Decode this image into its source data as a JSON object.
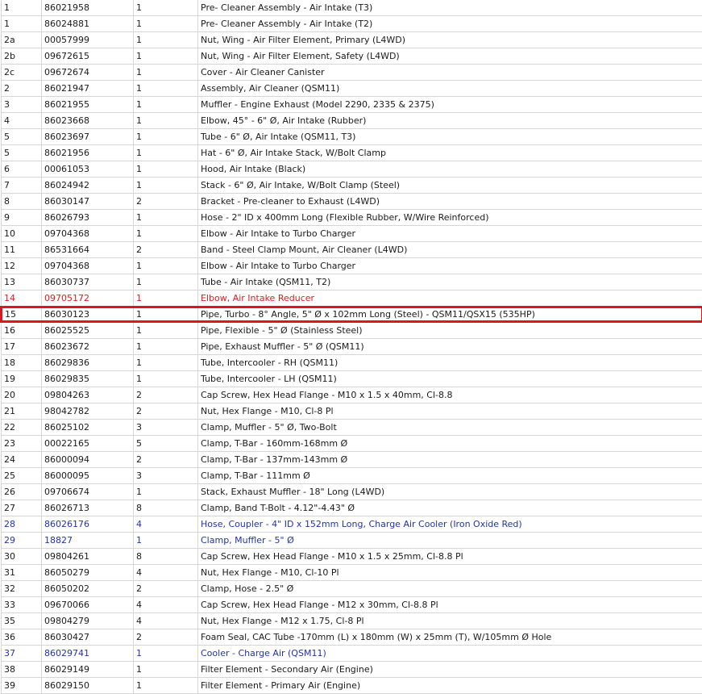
{
  "rows": [
    {
      "ref": "1",
      "part": "86021958",
      "qty": "1",
      "desc": "Pre- Cleaner Assembly - Air Intake (T3)",
      "style": ""
    },
    {
      "ref": "1",
      "part": "86024881",
      "qty": "1",
      "desc": "Pre- Cleaner Assembly - Air Intake (T2)",
      "style": ""
    },
    {
      "ref": "2a",
      "part": "00057999",
      "qty": "1",
      "desc": "Nut, Wing - Air Filter Element, Primary (L4WD)",
      "style": ""
    },
    {
      "ref": "2b",
      "part": "09672615",
      "qty": "1",
      "desc": "Nut, Wing - Air Filter Element, Safety (L4WD)",
      "style": ""
    },
    {
      "ref": "2c",
      "part": "09672674",
      "qty": "1",
      "desc": "Cover - Air Cleaner Canister",
      "style": ""
    },
    {
      "ref": "2",
      "part": "86021947",
      "qty": "1",
      "desc": "Assembly, Air Cleaner (QSM11)",
      "style": ""
    },
    {
      "ref": "3",
      "part": "86021955",
      "qty": "1",
      "desc": "Muffler - Engine Exhaust (Model 2290, 2335 & 2375)",
      "style": ""
    },
    {
      "ref": "4",
      "part": "86023668",
      "qty": "1",
      "desc": "Elbow, 45° - 6\" Ø, Air Intake (Rubber)",
      "style": ""
    },
    {
      "ref": "5",
      "part": "86023697",
      "qty": "1",
      "desc": "Tube - 6\" Ø, Air Intake (QSM11, T3)",
      "style": ""
    },
    {
      "ref": "5",
      "part": "86021956",
      "qty": "1",
      "desc": "Hat - 6\" Ø, Air Intake Stack, W/Bolt Clamp",
      "style": ""
    },
    {
      "ref": "6",
      "part": "00061053",
      "qty": "1",
      "desc": "Hood, Air Intake (Black)",
      "style": ""
    },
    {
      "ref": "7",
      "part": "86024942",
      "qty": "1",
      "desc": "Stack - 6\" Ø, Air Intake, W/Bolt Clamp (Steel)",
      "style": ""
    },
    {
      "ref": "8",
      "part": "86030147",
      "qty": "2",
      "desc": "Bracket - Pre-cleaner to Exhaust (L4WD)",
      "style": ""
    },
    {
      "ref": "9",
      "part": "86026793",
      "qty": "1",
      "desc": "Hose - 2\" ID x 400mm Long (Flexible Rubber, W/Wire Reinforced)",
      "style": ""
    },
    {
      "ref": "10",
      "part": "09704368",
      "qty": "1",
      "desc": "Elbow - Air Intake to Turbo Charger",
      "style": ""
    },
    {
      "ref": "11",
      "part": "86531664",
      "qty": "2",
      "desc": "Band - Steel Clamp Mount, Air Cleaner (L4WD)",
      "style": ""
    },
    {
      "ref": "12",
      "part": "09704368",
      "qty": "1",
      "desc": "Elbow - Air Intake to Turbo Charger",
      "style": ""
    },
    {
      "ref": "13",
      "part": "86030737",
      "qty": "1",
      "desc": "Tube - Air Intake (QSM11, T2)",
      "style": ""
    },
    {
      "ref": "14",
      "part": "09705172",
      "qty": "1",
      "desc": "Elbow, Air Intake Reducer",
      "style": "red"
    },
    {
      "ref": "15",
      "part": "86030123",
      "qty": "1",
      "desc": "Pipe, Turbo - 8° Angle, 5\" Ø x 102mm Long (Steel) - QSM11/QSX15 (535HP)",
      "style": "selected"
    },
    {
      "ref": "16",
      "part": "86025525",
      "qty": "1",
      "desc": "Pipe, Flexible - 5\" Ø (Stainless Steel)",
      "style": ""
    },
    {
      "ref": "17",
      "part": "86023672",
      "qty": "1",
      "desc": "Pipe, Exhaust Muffler - 5\" Ø (QSM11)",
      "style": ""
    },
    {
      "ref": "18",
      "part": "86029836",
      "qty": "1",
      "desc": "Tube, Intercooler - RH (QSM11)",
      "style": ""
    },
    {
      "ref": "19",
      "part": "86029835",
      "qty": "1",
      "desc": "Tube, Intercooler - LH (QSM11)",
      "style": ""
    },
    {
      "ref": "20",
      "part": "09804263",
      "qty": "2",
      "desc": "Cap Screw, Hex Head Flange - M10 x 1.5 x 40mm, Cl-8.8",
      "style": ""
    },
    {
      "ref": "21",
      "part": "98042782",
      "qty": "2",
      "desc": "Nut, Hex Flange - M10, Cl-8 Pl",
      "style": ""
    },
    {
      "ref": "22",
      "part": "86025102",
      "qty": "3",
      "desc": "Clamp, Muffler - 5\" Ø, Two-Bolt",
      "style": ""
    },
    {
      "ref": "23",
      "part": "00022165",
      "qty": "5",
      "desc": "Clamp, T-Bar - 160mm-168mm Ø",
      "style": ""
    },
    {
      "ref": "24",
      "part": "86000094",
      "qty": "2",
      "desc": "Clamp, T-Bar - 137mm-143mm Ø",
      "style": ""
    },
    {
      "ref": "25",
      "part": "86000095",
      "qty": "3",
      "desc": "Clamp, T-Bar - 111mm Ø",
      "style": ""
    },
    {
      "ref": "26",
      "part": "09706674",
      "qty": "1",
      "desc": "Stack, Exhaust Muffler - 18\" Long (L4WD)",
      "style": ""
    },
    {
      "ref": "27",
      "part": "86026713",
      "qty": "8",
      "desc": "Clamp, Band T-Bolt - 4.12\"-4.43\" Ø",
      "style": ""
    },
    {
      "ref": "28",
      "part": "86026176",
      "qty": "4",
      "desc": "Hose, Coupler - 4\" ID x 152mm Long, Charge Air Cooler (Iron Oxide Red)",
      "style": "blue"
    },
    {
      "ref": "29",
      "part": "18827",
      "qty": "1",
      "desc": "Clamp, Muffler - 5\" Ø",
      "style": "blue"
    },
    {
      "ref": "30",
      "part": "09804261",
      "qty": "8",
      "desc": "Cap Screw, Hex Head Flange - M10 x 1.5 x 25mm, Cl-8.8 Pl",
      "style": ""
    },
    {
      "ref": "31",
      "part": "86050279",
      "qty": "4",
      "desc": "Nut, Hex Flange - M10, Cl-10 Pl",
      "style": ""
    },
    {
      "ref": "32",
      "part": "86050202",
      "qty": "2",
      "desc": "Clamp, Hose - 2.5\" Ø",
      "style": ""
    },
    {
      "ref": "33",
      "part": "09670066",
      "qty": "4",
      "desc": "Cap Screw, Hex Head Flange - M12 x 30mm, Cl-8.8 Pl",
      "style": ""
    },
    {
      "ref": "35",
      "part": "09804279",
      "qty": "4",
      "desc": "Nut, Hex Flange - M12 x 1.75, Cl-8 Pl",
      "style": ""
    },
    {
      "ref": "36",
      "part": "86030427",
      "qty": "2",
      "desc": "Foam Seal, CAC Tube -170mm (L) x 180mm (W) x 25mm (T), W/105mm Ø Hole",
      "style": ""
    },
    {
      "ref": "37",
      "part": "86029741",
      "qty": "1",
      "desc": "Cooler - Charge Air (QSM11)",
      "style": "blue"
    },
    {
      "ref": "38",
      "part": "86029149",
      "qty": "1",
      "desc": "Filter Element - Secondary Air (Engine)",
      "style": ""
    },
    {
      "ref": "39",
      "part": "86029150",
      "qty": "1",
      "desc": "Filter Element - Primary Air (Engine)",
      "style": ""
    }
  ]
}
